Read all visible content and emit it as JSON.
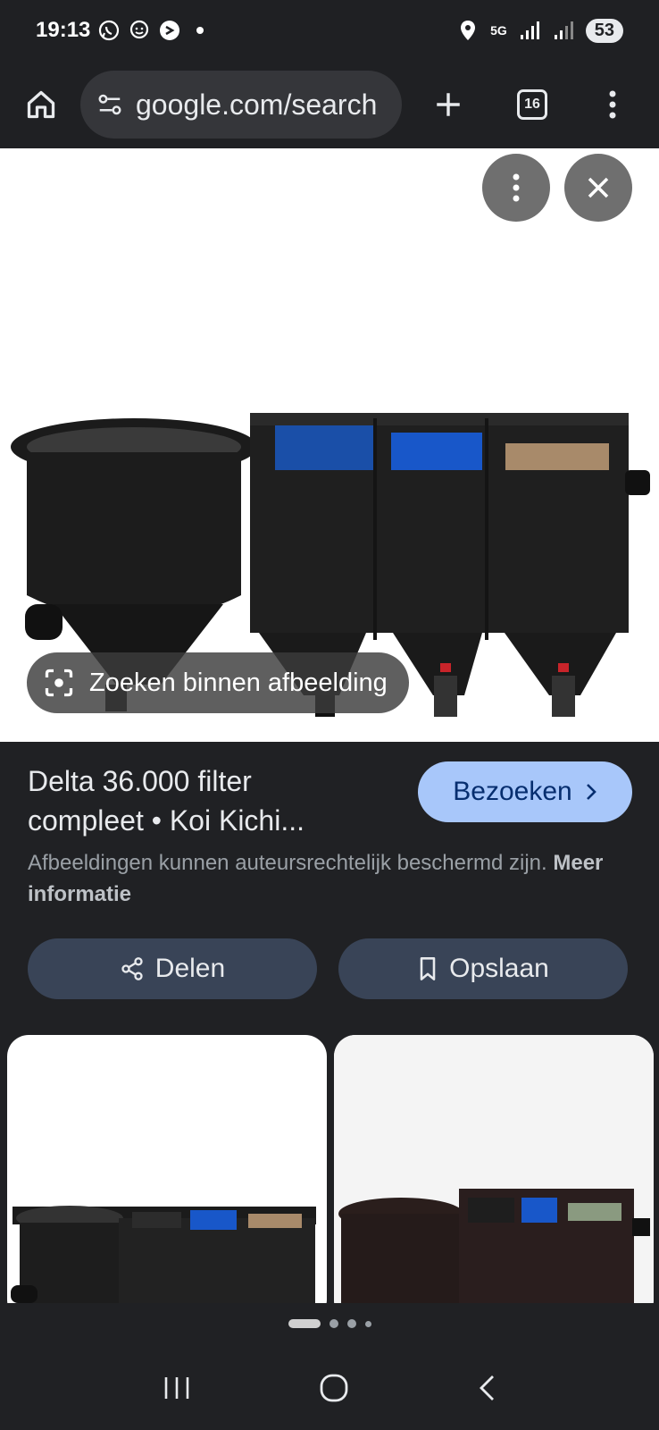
{
  "status": {
    "time": "19:13",
    "network": "5G",
    "battery": "53"
  },
  "toolbar": {
    "url": "google.com/search",
    "tab_count": "16"
  },
  "viewer": {
    "lens_label": "Zoeken binnen afbeelding"
  },
  "result": {
    "title_line1": "Delta 36.000 filter",
    "title_line2": "compleet • Koi Kichi...",
    "visit_label": "Bezoeken",
    "copyright_text": "Afbeeldingen kunnen auteursrechtelijk beschermd zijn.",
    "more_info": "Meer informatie",
    "share_label": "Delen",
    "save_label": "Opslaan"
  }
}
